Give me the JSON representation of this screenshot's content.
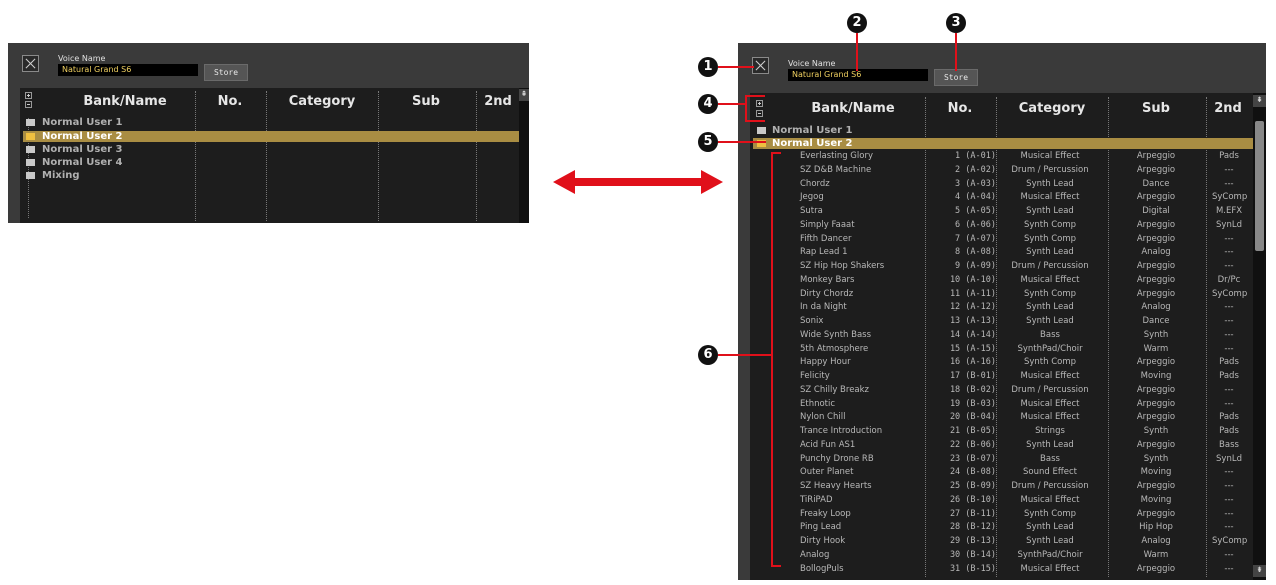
{
  "left_panel": {
    "voice_name_label": "Voice Name",
    "voice_name_value": "Natural Grand S6",
    "store_label": "Store",
    "headers": [
      "Bank/Name",
      "No.",
      "Category",
      "Sub",
      "2nd"
    ],
    "folders": [
      "Normal User 1",
      "Normal User 2",
      "Normal User 3",
      "Normal User 4",
      "Mixing"
    ],
    "selected_folder": "Normal User 2"
  },
  "right_panel": {
    "voice_name_label": "Voice Name",
    "voice_name_value": "Natural Grand S6",
    "store_label": "Store",
    "headers": [
      "Bank/Name",
      "No.",
      "Category",
      "Sub",
      "2nd"
    ],
    "folders": [
      "Normal User 1",
      "Normal User 2"
    ],
    "selected_folder": "Normal User 2",
    "voices": [
      {
        "name": "Everlasting Glory",
        "no": "1 (A-01)",
        "category": "Musical Effect",
        "sub": "Arpeggio",
        "second": "Pads"
      },
      {
        "name": "SZ D&B Machine",
        "no": "2 (A-02)",
        "category": "Drum / Percussion",
        "sub": "Arpeggio",
        "second": "---"
      },
      {
        "name": "Chordz",
        "no": "3 (A-03)",
        "category": "Synth Lead",
        "sub": "Dance",
        "second": "---"
      },
      {
        "name": "Jegog",
        "no": "4 (A-04)",
        "category": "Musical Effect",
        "sub": "Arpeggio",
        "second": "SyComp"
      },
      {
        "name": "Sutra",
        "no": "5 (A-05)",
        "category": "Synth Lead",
        "sub": "Digital",
        "second": "M.EFX"
      },
      {
        "name": "Simply Faaat",
        "no": "6 (A-06)",
        "category": "Synth Comp",
        "sub": "Arpeggio",
        "second": "SynLd"
      },
      {
        "name": "Fifth Dancer",
        "no": "7 (A-07)",
        "category": "Synth Comp",
        "sub": "Arpeggio",
        "second": "---"
      },
      {
        "name": "Rap Lead 1",
        "no": "8 (A-08)",
        "category": "Synth Lead",
        "sub": "Analog",
        "second": "---"
      },
      {
        "name": "SZ Hip Hop Shakers",
        "no": "9 (A-09)",
        "category": "Drum / Percussion",
        "sub": "Arpeggio",
        "second": "---"
      },
      {
        "name": "Monkey Bars",
        "no": "10 (A-10)",
        "category": "Musical Effect",
        "sub": "Arpeggio",
        "second": "Dr/Pc"
      },
      {
        "name": "Dirty Chordz",
        "no": "11 (A-11)",
        "category": "Synth Comp",
        "sub": "Arpeggio",
        "second": "SyComp"
      },
      {
        "name": "In da Night",
        "no": "12 (A-12)",
        "category": "Synth Lead",
        "sub": "Analog",
        "second": "---"
      },
      {
        "name": "Sonix",
        "no": "13 (A-13)",
        "category": "Synth Lead",
        "sub": "Dance",
        "second": "---"
      },
      {
        "name": "Wide Synth Bass",
        "no": "14 (A-14)",
        "category": "Bass",
        "sub": "Synth",
        "second": "---"
      },
      {
        "name": "5th Atmosphere",
        "no": "15 (A-15)",
        "category": "SynthPad/Choir",
        "sub": "Warm",
        "second": "---"
      },
      {
        "name": "Happy Hour",
        "no": "16 (A-16)",
        "category": "Synth Comp",
        "sub": "Arpeggio",
        "second": "Pads"
      },
      {
        "name": "Felicity",
        "no": "17 (B-01)",
        "category": "Musical Effect",
        "sub": "Moving",
        "second": "Pads"
      },
      {
        "name": "SZ Chilly Breakz",
        "no": "18 (B-02)",
        "category": "Drum / Percussion",
        "sub": "Arpeggio",
        "second": "---"
      },
      {
        "name": "Ethnotic",
        "no": "19 (B-03)",
        "category": "Musical Effect",
        "sub": "Arpeggio",
        "second": "---"
      },
      {
        "name": "Nylon Chill",
        "no": "20 (B-04)",
        "category": "Musical Effect",
        "sub": "Arpeggio",
        "second": "Pads"
      },
      {
        "name": "Trance Introduction",
        "no": "21 (B-05)",
        "category": "Strings",
        "sub": "Synth",
        "second": "Pads"
      },
      {
        "name": "Acid Fun AS1",
        "no": "22 (B-06)",
        "category": "Synth Lead",
        "sub": "Arpeggio",
        "second": "Bass"
      },
      {
        "name": "Punchy Drone RB",
        "no": "23 (B-07)",
        "category": "Bass",
        "sub": "Synth",
        "second": "SynLd"
      },
      {
        "name": "Outer Planet",
        "no": "24 (B-08)",
        "category": "Sound Effect",
        "sub": "Moving",
        "second": "---"
      },
      {
        "name": "SZ Heavy Hearts",
        "no": "25 (B-09)",
        "category": "Drum / Percussion",
        "sub": "Arpeggio",
        "second": "---"
      },
      {
        "name": "TiRiPAD",
        "no": "26 (B-10)",
        "category": "Musical Effect",
        "sub": "Moving",
        "second": "---"
      },
      {
        "name": "Freaky Loop",
        "no": "27 (B-11)",
        "category": "Synth Comp",
        "sub": "Arpeggio",
        "second": "---"
      },
      {
        "name": "Ping Lead",
        "no": "28 (B-12)",
        "category": "Synth Lead",
        "sub": "Hip Hop",
        "second": "---"
      },
      {
        "name": "Dirty Hook",
        "no": "29 (B-13)",
        "category": "Synth Lead",
        "sub": "Analog",
        "second": "SyComp"
      },
      {
        "name": "Analog",
        "no": "30 (B-14)",
        "category": "SynthPad/Choir",
        "sub": "Warm",
        "second": "---"
      },
      {
        "name": "BollogPuls",
        "no": "31 (B-15)",
        "category": "Musical Effect",
        "sub": "Arpeggio",
        "second": "---"
      }
    ]
  },
  "callouts": [
    "1",
    "2",
    "3",
    "4",
    "5",
    "6"
  ],
  "colors": {
    "panel_bg": "#3a3a3a",
    "list_bg": "#1d1d1d",
    "selection": "#a98d43",
    "voice_name_text": "#f0d060",
    "arrow": "#e0101a"
  },
  "icons": [
    "close-icon",
    "expand-icon",
    "collapse-icon",
    "folder-icon",
    "open-folder-icon",
    "scroll-up-icon",
    "scroll-down-icon",
    "double-arrow-icon"
  ]
}
